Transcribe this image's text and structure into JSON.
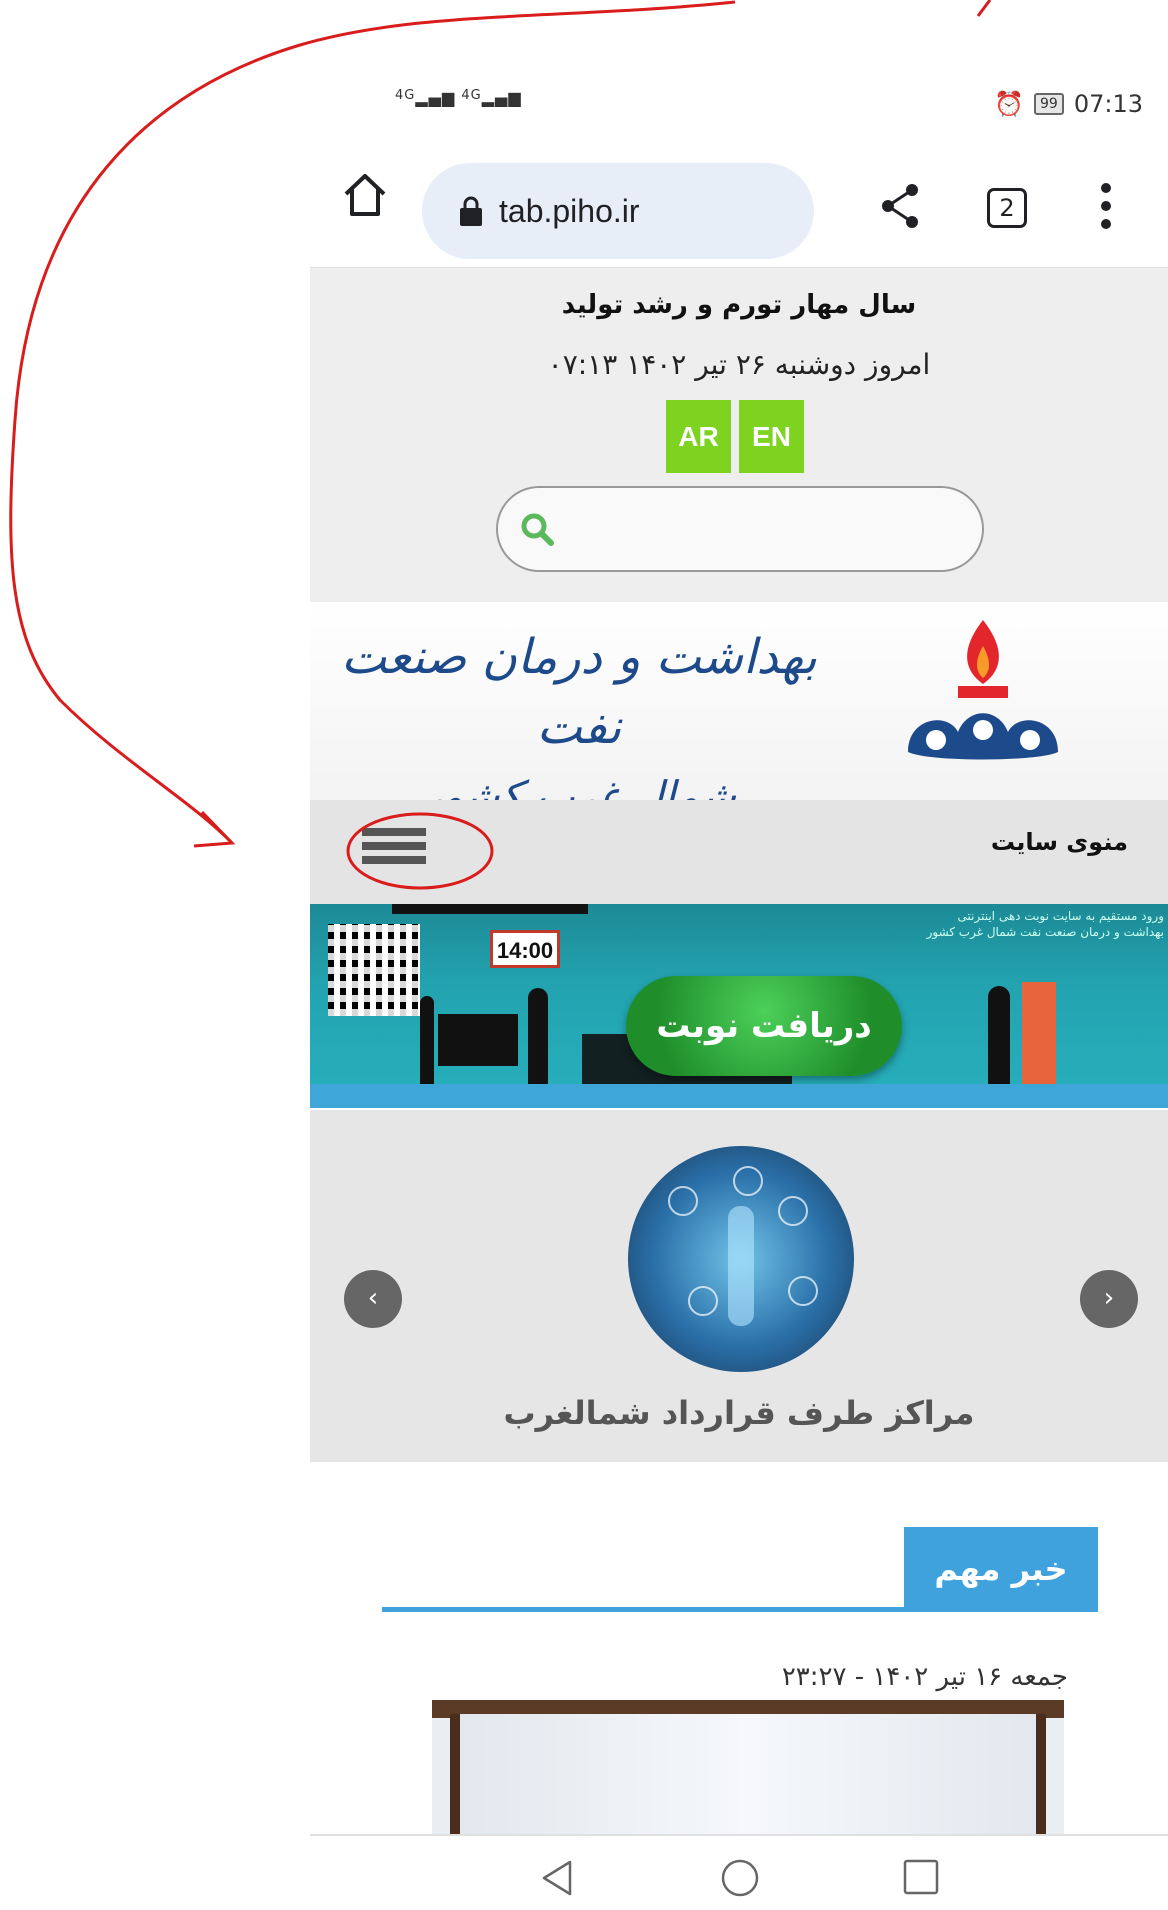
{
  "status_bar": {
    "signal_text": "4G",
    "battery": "99",
    "time": "07:13"
  },
  "browser": {
    "url": "tab.piho.ir",
    "tab_count": "2"
  },
  "site": {
    "slogan": "سال مهار تورم و رشد تولید",
    "today_date": "امروز دوشنبه ۲۶ تیر ۱۴۰۲   ۰۷:۱۳",
    "lang_ar": "AR",
    "lang_en": "EN",
    "search_placeholder": "",
    "logo_line1": "بهداشت و درمان صنعت نفت",
    "logo_line2": "شمال غرب کشور",
    "menu_label": "منوی سایت"
  },
  "appointment_banner": {
    "button_label": "دریافت نوبت",
    "clock": "14:00",
    "note_line1": "ورود مستقیم به سایت نوبت دهی اینترنتی",
    "note_line2": "بهداشت و درمان صنعت نفت شمال غرب کشور"
  },
  "carousel": {
    "caption": "مراکز طرف قرارداد شمالغرب",
    "prev_glyph": "‹",
    "next_glyph": "›"
  },
  "news": {
    "tab_label": "خبر مهم",
    "date": "جمعه ۱۶ تیر ۱۴۰۲ - ۲۳:۲۷"
  },
  "colors": {
    "annotation": "#d91c1c",
    "lang_button": "#7ed321",
    "news_accent": "#3fa2dc"
  }
}
